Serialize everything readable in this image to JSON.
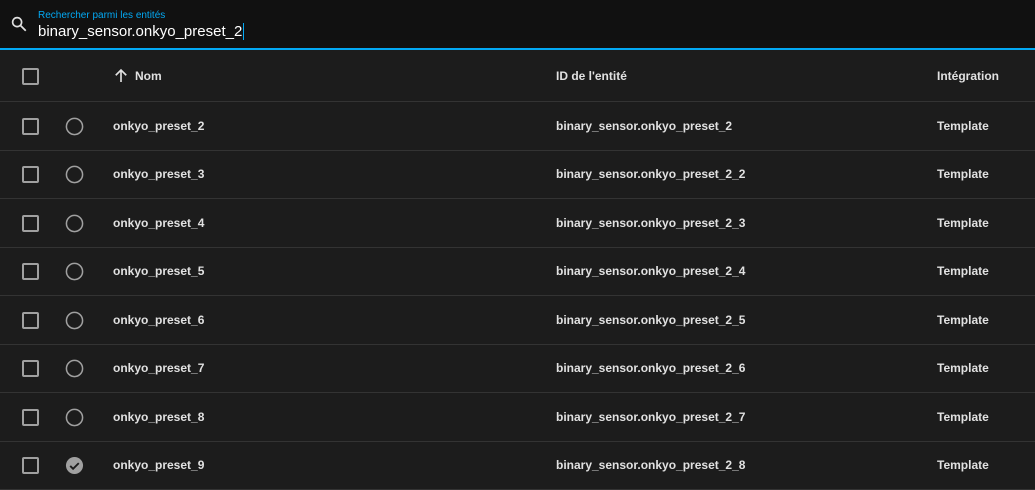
{
  "search": {
    "label": "Rechercher parmi les entités",
    "value": "binary_sensor.onkyo_preset_2"
  },
  "columns": {
    "name": "Nom",
    "entity_id": "ID de l'entité",
    "integration": "Intégration"
  },
  "rows": [
    {
      "name": "onkyo_preset_2",
      "entity_id": "binary_sensor.onkyo_preset_2",
      "integration": "Template",
      "status": "unavailable"
    },
    {
      "name": "onkyo_preset_3",
      "entity_id": "binary_sensor.onkyo_preset_2_2",
      "integration": "Template",
      "status": "unavailable"
    },
    {
      "name": "onkyo_preset_4",
      "entity_id": "binary_sensor.onkyo_preset_2_3",
      "integration": "Template",
      "status": "unavailable"
    },
    {
      "name": "onkyo_preset_5",
      "entity_id": "binary_sensor.onkyo_preset_2_4",
      "integration": "Template",
      "status": "unavailable"
    },
    {
      "name": "onkyo_preset_6",
      "entity_id": "binary_sensor.onkyo_preset_2_5",
      "integration": "Template",
      "status": "unavailable"
    },
    {
      "name": "onkyo_preset_7",
      "entity_id": "binary_sensor.onkyo_preset_2_6",
      "integration": "Template",
      "status": "unavailable"
    },
    {
      "name": "onkyo_preset_8",
      "entity_id": "binary_sensor.onkyo_preset_2_7",
      "integration": "Template",
      "status": "unavailable"
    },
    {
      "name": "onkyo_preset_9",
      "entity_id": "binary_sensor.onkyo_preset_2_8",
      "integration": "Template",
      "status": "ok"
    }
  ]
}
